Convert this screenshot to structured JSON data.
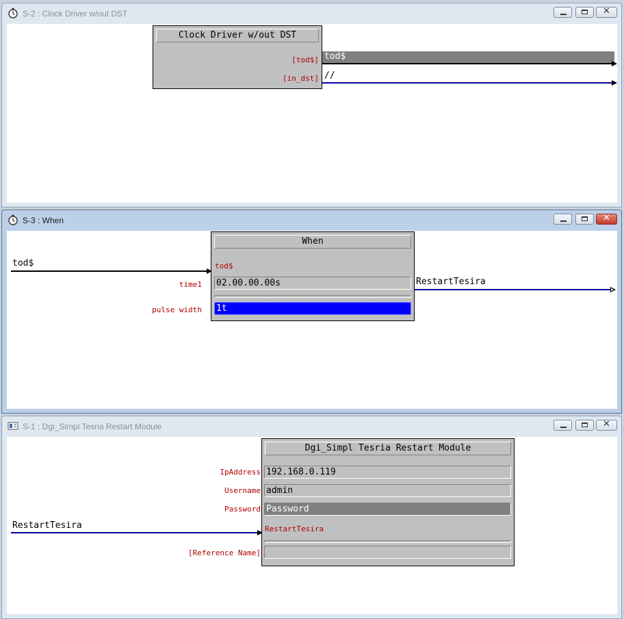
{
  "windows": [
    {
      "title": "S-2 : Clock Driver w/out DST",
      "symbol": {
        "title": "Clock Driver w/out DST",
        "outputs": [
          {
            "label": "[tod$]",
            "signal": "tod$"
          },
          {
            "label": "[in_dst]",
            "signal": "//"
          }
        ]
      }
    },
    {
      "title": "S-3 : When",
      "input_signal": "tod$",
      "symbol": {
        "title": "When",
        "input_label": "tod$",
        "param1_label": "time1",
        "param1_value": "02.00.00.00s",
        "param2_label": "pulse width",
        "param2_value": "1t"
      },
      "output_signal": "RestartTesira"
    },
    {
      "title": "S-1 : Dgi_Simpl Tesria Restart Module",
      "input_signal": "RestartTesira",
      "symbol": {
        "title": "Dgi_Simpl Tesria Restart Module",
        "params": [
          {
            "label": "IpAddress",
            "value": "192.168.0.119"
          },
          {
            "label": "Username",
            "value": "admin"
          },
          {
            "label": "Password",
            "value": "Password"
          }
        ],
        "input_label": "RestartTesira",
        "ref_label": "[Reference Name]",
        "ref_value": ""
      }
    }
  ],
  "controls": {
    "minimize": "",
    "maximize": "",
    "close": "✕"
  },
  "icons": [
    "stopwatch-icon",
    "module-icon",
    "minimize-icon",
    "maximize-icon",
    "close-icon"
  ]
}
